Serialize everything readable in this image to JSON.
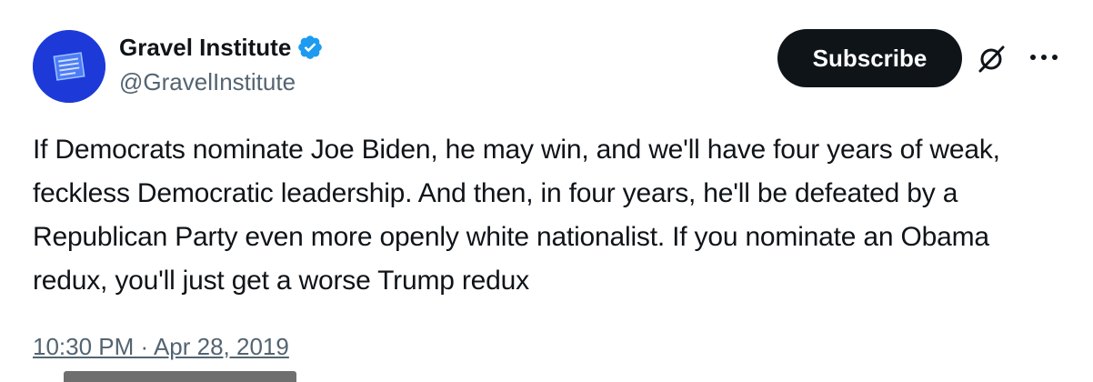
{
  "author": {
    "display_name": "Gravel Institute",
    "handle": "@GravelInstitute",
    "verified": true,
    "avatar_icon": "gravel-institute-logo",
    "avatar_color": "#1d3ad9"
  },
  "actions": {
    "subscribe_label": "Subscribe",
    "grok_icon": "grok-icon",
    "more_icon": "more-dots-icon"
  },
  "tweet": {
    "text": "If Democrats nominate Joe Biden, he may win, and we'll have four years of weak, feckless Democratic leadership. And then, in four years, he'll be defeated by a Republican Party even more openly white nationalist. If you nominate an Obama redux, you'll just get a worse Trump redux",
    "timestamp": "10:30 PM · Apr 28, 2019"
  },
  "colors": {
    "text_primary": "#0f1419",
    "text_secondary": "#536471",
    "verified_blue": "#1d9bf0",
    "button_bg": "#0f1419"
  }
}
